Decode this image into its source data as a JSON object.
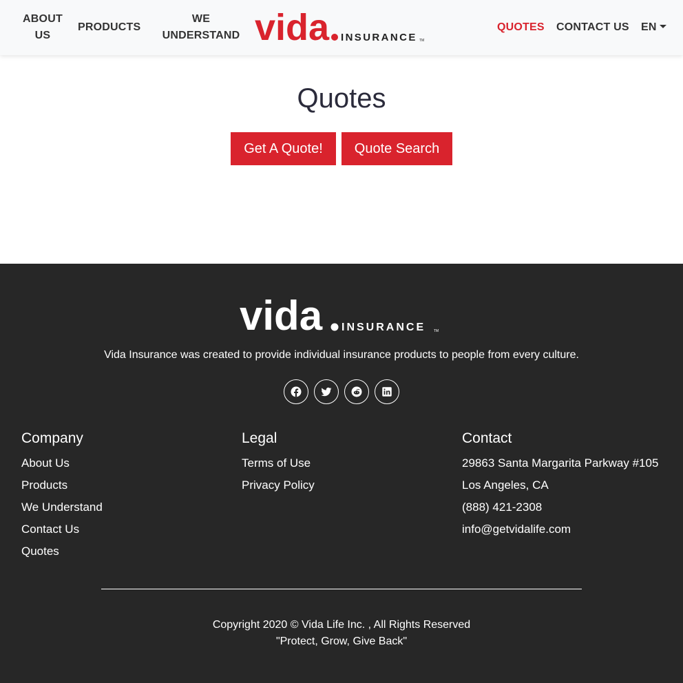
{
  "nav": {
    "about": "ABOUT US",
    "products": "PRODUCTS",
    "we_understand": "WE UNDERSTAND",
    "quotes": "QUOTES",
    "contact": "CONTACT US",
    "language": "EN"
  },
  "brand": {
    "name": "vida",
    "suffix": "INSURANCE",
    "tm": "TM",
    "accent_color": "#d9232d"
  },
  "main": {
    "title": "Quotes",
    "get_quote_label": "Get A Quote!",
    "quote_search_label": "Quote Search"
  },
  "footer": {
    "tagline": "Vida Insurance was created to provide individual insurance products to people from every culture.",
    "social": [
      "facebook-icon",
      "twitter-icon",
      "reddit-icon",
      "linkedin-icon"
    ],
    "company": {
      "heading": "Company",
      "links": [
        "About Us",
        "Products",
        "We Understand",
        "Contact Us",
        "Quotes"
      ]
    },
    "legal": {
      "heading": "Legal",
      "links": [
        "Terms of Use",
        "Privacy Policy"
      ]
    },
    "contact": {
      "heading": "Contact",
      "address_line1": "29863 Santa Margarita Parkway #105",
      "address_line2": "Los Angeles, CA",
      "phone": "(888) 421-2308",
      "email": "info@getvidalife.com"
    },
    "copyright": "Copyright 2020 © Vida Life Inc. , All Rights Reserved",
    "motto": "\"Protect, Grow, Give Back\""
  }
}
